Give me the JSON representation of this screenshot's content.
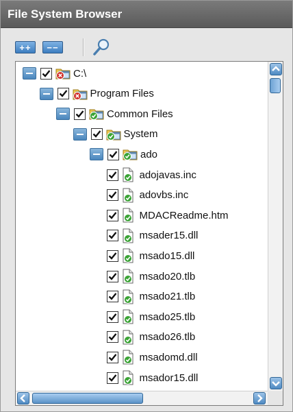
{
  "window": {
    "title": "File System Browser"
  },
  "toolbar": {
    "expand_all_label": "++",
    "collapse_all_label": "−−"
  },
  "tree": {
    "nodes": [
      {
        "label": "C:\\",
        "level": 0,
        "type": "folder",
        "status": "error",
        "expanded": true,
        "checked": true
      },
      {
        "label": "Program Files",
        "level": 1,
        "type": "folder",
        "status": "error",
        "expanded": true,
        "checked": true
      },
      {
        "label": "Common Files",
        "level": 2,
        "type": "folder",
        "status": "ok",
        "expanded": true,
        "checked": true
      },
      {
        "label": "System",
        "level": 3,
        "type": "folder",
        "status": "ok",
        "expanded": true,
        "checked": true
      },
      {
        "label": "ado",
        "level": 4,
        "type": "folder",
        "status": "ok",
        "expanded": true,
        "checked": true
      },
      {
        "label": "adojavas.inc",
        "level": 5,
        "type": "file",
        "status": "ok",
        "checked": true
      },
      {
        "label": "adovbs.inc",
        "level": 5,
        "type": "file",
        "status": "ok",
        "checked": true
      },
      {
        "label": "MDACReadme.htm",
        "level": 5,
        "type": "file",
        "status": "ok",
        "checked": true
      },
      {
        "label": "msader15.dll",
        "level": 5,
        "type": "file",
        "status": "ok",
        "checked": true
      },
      {
        "label": "msado15.dll",
        "level": 5,
        "type": "file",
        "status": "ok",
        "checked": true
      },
      {
        "label": "msado20.tlb",
        "level": 5,
        "type": "file",
        "status": "ok",
        "checked": true
      },
      {
        "label": "msado21.tlb",
        "level": 5,
        "type": "file",
        "status": "ok",
        "checked": true
      },
      {
        "label": "msado25.tlb",
        "level": 5,
        "type": "file",
        "status": "ok",
        "checked": true
      },
      {
        "label": "msado26.tlb",
        "level": 5,
        "type": "file",
        "status": "ok",
        "checked": true
      },
      {
        "label": "msadomd.dll",
        "level": 5,
        "type": "file",
        "status": "ok",
        "checked": true
      },
      {
        "label": "msador15.dll",
        "level": 5,
        "type": "file",
        "status": "ok",
        "checked": true
      }
    ]
  },
  "colors": {
    "titlebar": "#666666",
    "accent_blue": "#4a86bd",
    "status_ok": "#3aa335",
    "status_error": "#d0302a"
  }
}
